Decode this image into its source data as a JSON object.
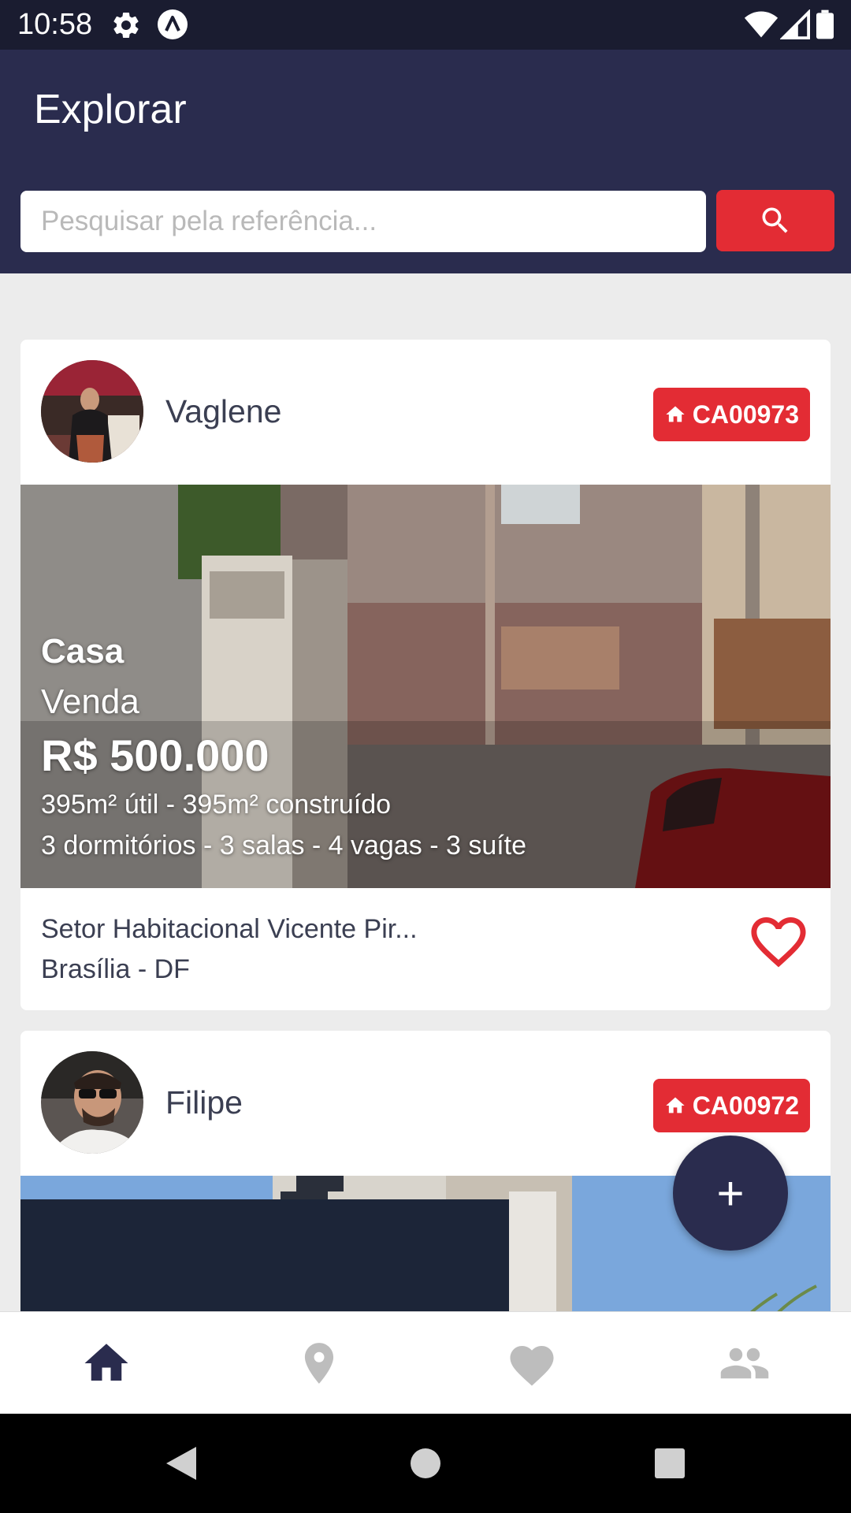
{
  "status_bar": {
    "time": "10:58",
    "icons": [
      "gear-icon",
      "app-logo-icon",
      "wifi-icon",
      "signal-icon",
      "battery-icon"
    ]
  },
  "header": {
    "title": "Explorar",
    "search_placeholder": "Pesquisar pela referência...",
    "search_icon": "search-icon"
  },
  "colors": {
    "primary": "#2a2c4e",
    "accent": "#e32c34",
    "status_bar": "#1a1c30",
    "background": "#ececec"
  },
  "listings": [
    {
      "owner": "Vaglene",
      "reference": "CA00973",
      "type": "Casa",
      "deal": "Venda",
      "price": "R$ 500.000",
      "area": "395m² útil - 395m² construído",
      "rooms": "3 dormitórios - 3 salas - 4 vagas - 3 suíte",
      "address": "Setor Habitacional Vicente Pir...",
      "city": "Brasília - DF",
      "favorite_icon": "heart-outline-icon"
    },
    {
      "owner": "Filipe",
      "reference": "CA00972"
    }
  ],
  "fab": {
    "label": "+"
  },
  "bottom_nav": {
    "items": [
      {
        "icon": "home-icon",
        "active": true
      },
      {
        "icon": "map-pin-icon",
        "active": false
      },
      {
        "icon": "heart-icon",
        "active": false
      },
      {
        "icon": "people-icon",
        "active": false
      }
    ]
  }
}
